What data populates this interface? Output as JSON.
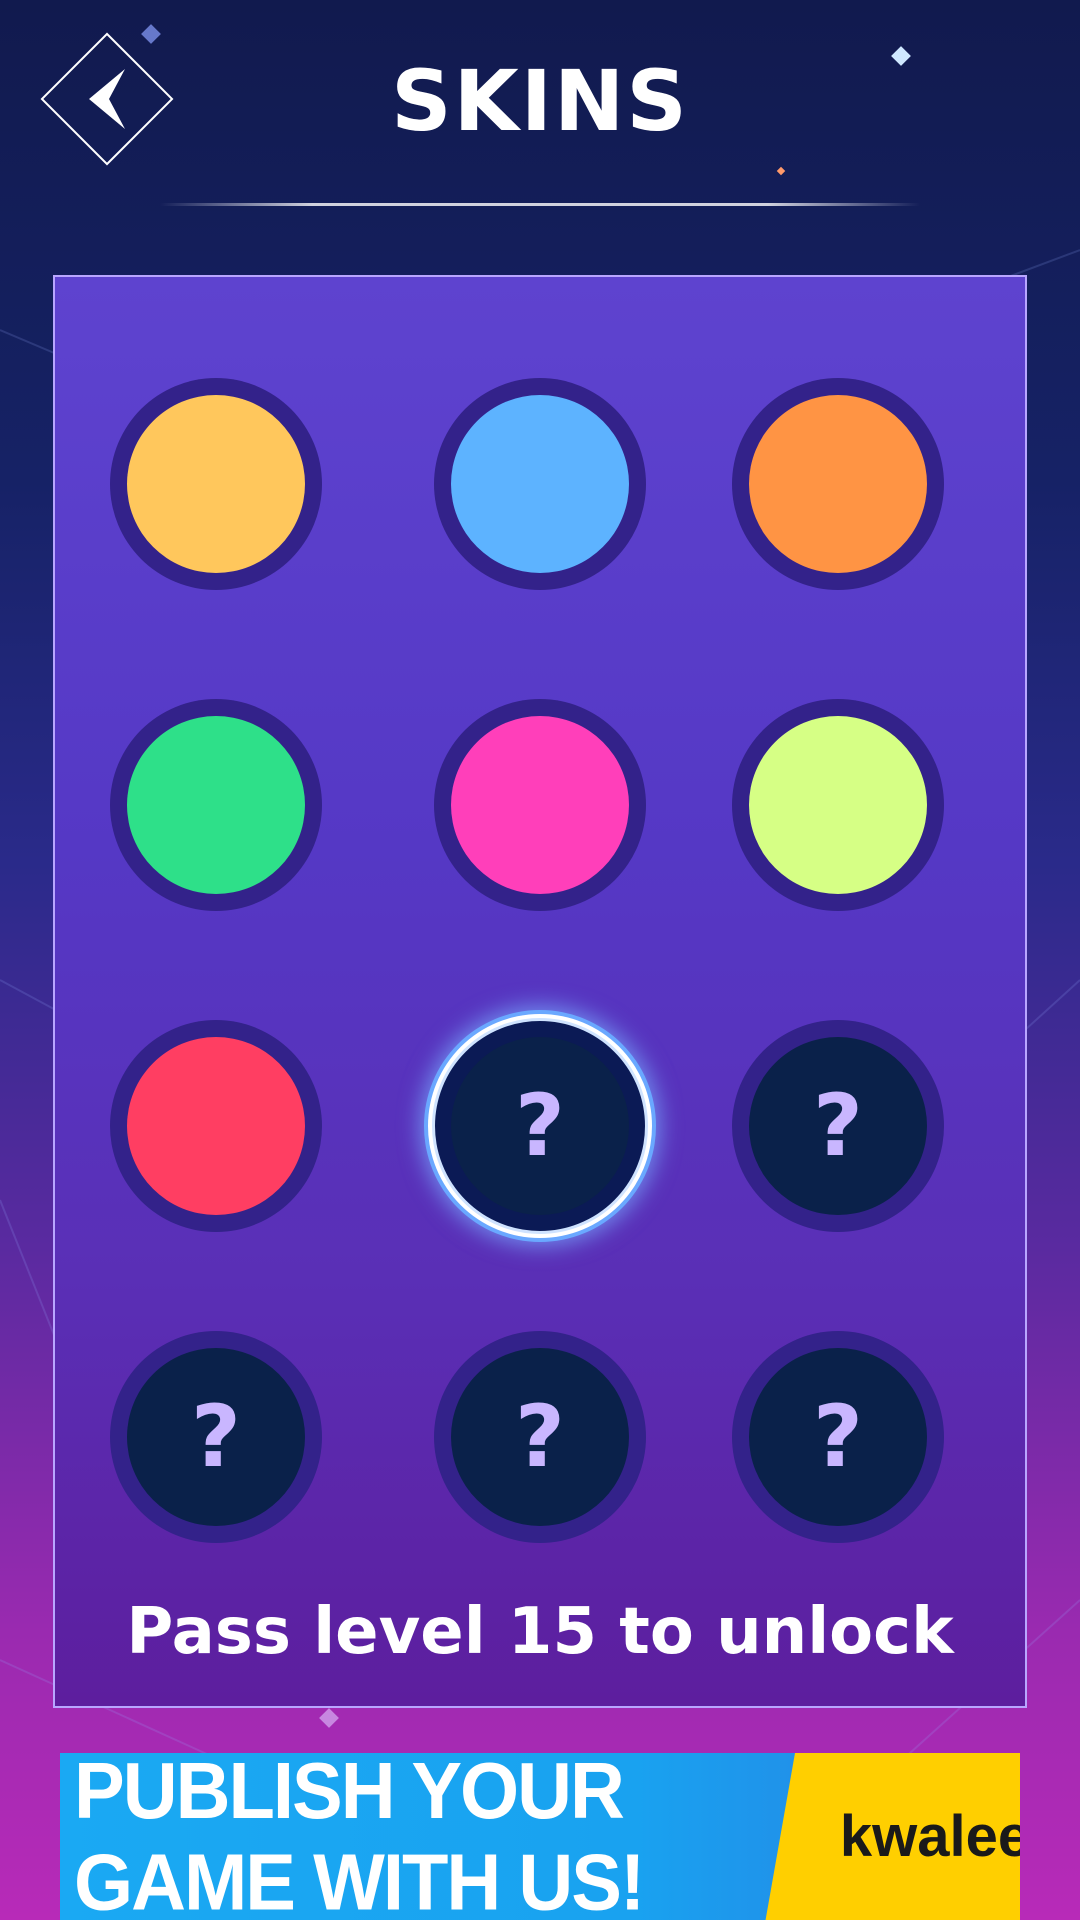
{
  "header": {
    "title": "SKINS",
    "back_icon": "chevron-left-icon"
  },
  "skins": [
    {
      "id": "yellow",
      "color": "#ffc75c",
      "locked": false,
      "selected": false
    },
    {
      "id": "blue",
      "color": "#5db3ff",
      "locked": false,
      "selected": false
    },
    {
      "id": "orange",
      "color": "#ff9444",
      "locked": false,
      "selected": false
    },
    {
      "id": "green",
      "color": "#2ee089",
      "locked": false,
      "selected": false
    },
    {
      "id": "pink",
      "color": "#ff3fba",
      "locked": false,
      "selected": false
    },
    {
      "id": "lime",
      "color": "#d6ff85",
      "locked": false,
      "selected": false
    },
    {
      "id": "red",
      "color": "#ff3e62",
      "locked": false,
      "selected": false
    },
    {
      "id": "locked-1",
      "color": "#0a214a",
      "locked": true,
      "selected": true,
      "label": "?"
    },
    {
      "id": "locked-2",
      "color": "#0a214a",
      "locked": true,
      "selected": false,
      "label": "?"
    },
    {
      "id": "locked-3",
      "color": "#0a214a",
      "locked": true,
      "selected": false,
      "label": "?"
    },
    {
      "id": "locked-4",
      "color": "#0a214a",
      "locked": true,
      "selected": false,
      "label": "?"
    },
    {
      "id": "locked-5",
      "color": "#0a214a",
      "locked": true,
      "selected": false,
      "label": "?"
    }
  ],
  "unlock_message": "Pass level 15 to unlock",
  "ad": {
    "headline": "PUBLISH YOUR GAME WITH US!",
    "brand": "kwalee"
  },
  "colors": {
    "background_top": "#111a4e",
    "background_bottom": "#b82ab8",
    "panel": "#5538c5",
    "ring": "#33228a",
    "ad_blue": "#1aa9f3",
    "ad_yellow": "#ffcf00"
  }
}
